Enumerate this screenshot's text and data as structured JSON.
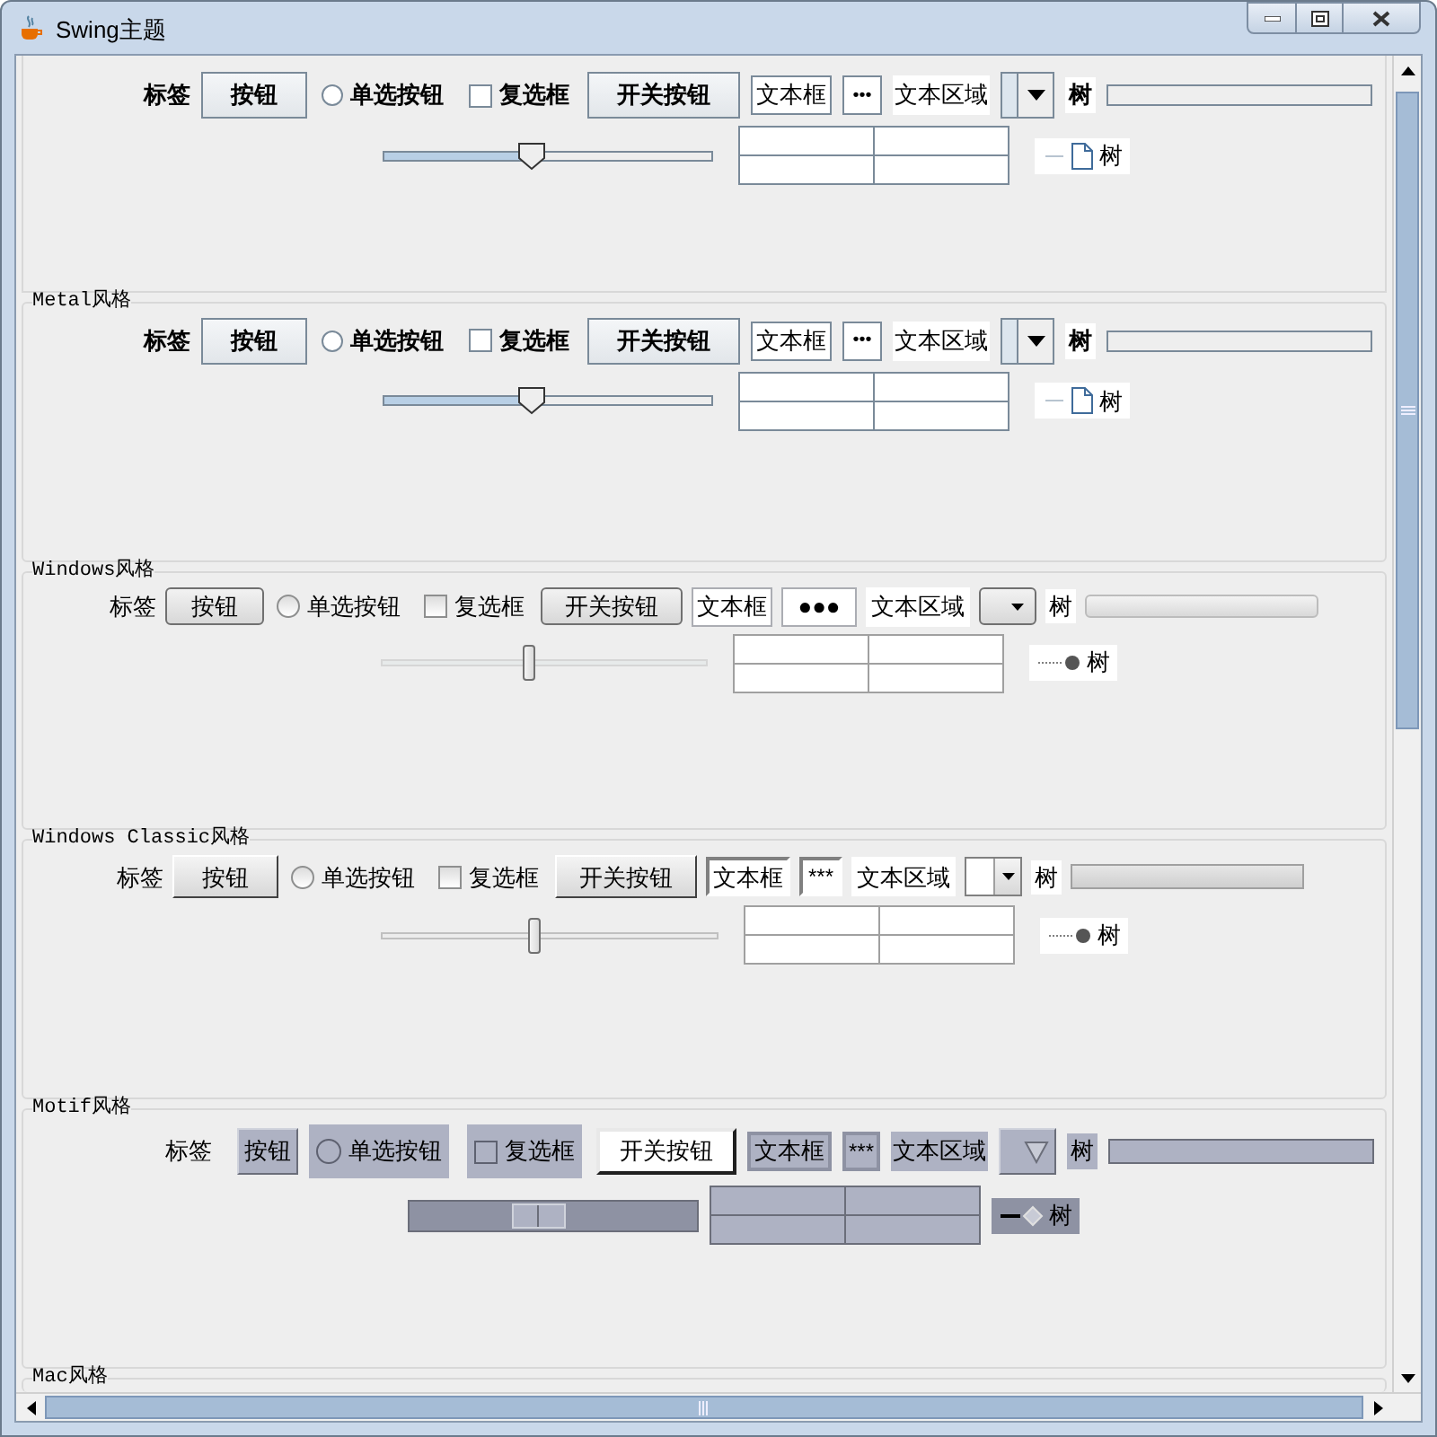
{
  "window": {
    "title": "Swing主题"
  },
  "sections": [
    {
      "kind": "metal",
      "label": "标签",
      "button": "按钮",
      "radio": {
        "label": "单选按钮",
        "selected": false
      },
      "checkbox": {
        "label": "复选框",
        "checked": false
      },
      "toggle": {
        "label": "开关按钮",
        "on": false
      },
      "text_field": "文本框",
      "password": "•••",
      "text_area": "文本区域",
      "list_item": "树",
      "progress": {
        "level": 0
      },
      "slider": {
        "level": 0.45
      },
      "tree_root": "树"
    },
    {
      "kind": "metal",
      "title": "Metal风格",
      "label": "标签",
      "button": "按钮",
      "radio": {
        "label": "单选按钮",
        "selected": false
      },
      "checkbox": {
        "label": "复选框",
        "checked": false
      },
      "toggle": {
        "label": "开关按钮",
        "on": false
      },
      "text_field": "文本框",
      "password": "•••",
      "text_area": "文本区域",
      "list_item": "树",
      "progress": {
        "level": 0
      },
      "slider": {
        "level": 0.45
      },
      "tree_root": "树"
    },
    {
      "kind": "windows",
      "title": "Windows风格",
      "label": "标签",
      "button": "按钮",
      "radio": {
        "label": "单选按钮",
        "selected": false
      },
      "checkbox": {
        "label": "复选框",
        "checked": false
      },
      "toggle": {
        "label": "开关按钮",
        "on": false
      },
      "text_field": "文本框",
      "password": "●●●",
      "text_area": "文本区域",
      "list_item": "树",
      "progress": {
        "level": 0
      },
      "slider": {
        "level": 0.45
      },
      "tree_root": "树"
    },
    {
      "kind": "classic",
      "title": "Windows Classic风格",
      "label": "标签",
      "button": "按钮",
      "radio": {
        "label": "单选按钮",
        "selected": false
      },
      "checkbox": {
        "label": "复选框",
        "checked": false
      },
      "toggle": {
        "label": "开关按钮",
        "on": false
      },
      "text_field": "文本框",
      "password": "***",
      "text_area": "文本区域",
      "list_item": "树",
      "progress": {
        "level": 0
      },
      "slider": {
        "level": 0.45
      },
      "tree_root": "树"
    },
    {
      "kind": "motif",
      "title": "Motif风格",
      "label": "标签",
      "button": "按钮",
      "radio": {
        "label": "单选按钮",
        "selected": false
      },
      "checkbox": {
        "label": "复选框",
        "checked": false
      },
      "toggle": {
        "label": "开关按钮",
        "on": false
      },
      "text_field": "文本框",
      "password": "***",
      "text_area": "文本区域",
      "list_item": "树",
      "progress": {
        "level": 0
      },
      "slider": {
        "level": 0.45
      },
      "tree_root": "树"
    },
    {
      "kind": "metal",
      "title": "Mac风格"
    }
  ]
}
